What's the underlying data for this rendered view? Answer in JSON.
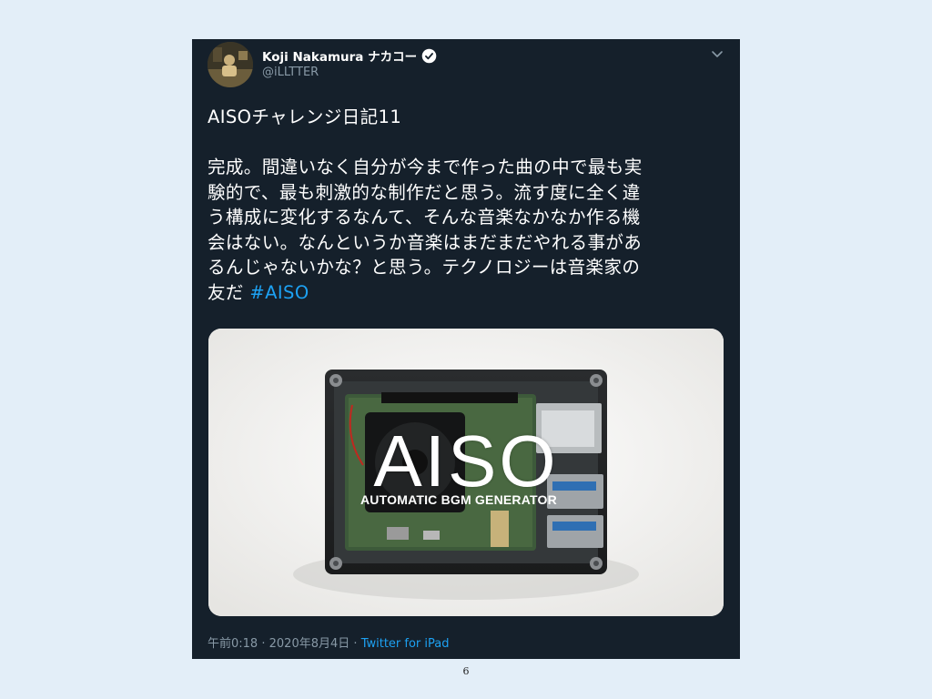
{
  "tweet": {
    "author_name": "Koji Nakamura ナカコー",
    "author_handle": "@iLLTTER",
    "text_lines": [
      "AISOチャレンジ日記11",
      "完成。間違いなく自分が今まで作った曲の中で最も実",
      "験的で、最も刺激的な制作だと思う。流す度に全く違",
      "う構成に変化するなんて、そんな音楽なかなか作る機",
      "会はない。なんというか音楽はまだまだやれる事があ",
      "るんじゃないかな？と思う。テクノロジーは音楽家の",
      "友だ"
    ],
    "hashtag": "#AISO",
    "time": "午前0:18",
    "date": "2020年8月4日",
    "separator": "·",
    "source": "Twitter for iPad",
    "media": {
      "logo_text": "AISO",
      "logo_subtitle": "AUTOMATIC BGM GENERATOR"
    }
  },
  "page": {
    "number": "6"
  },
  "colors": {
    "card_background": "#15202b",
    "page_background": "#e3eef8",
    "link": "#1da1f2",
    "muted": "#8899a6"
  },
  "icons": {
    "verified": "verified-badge-icon",
    "more": "chevron-down-icon"
  }
}
